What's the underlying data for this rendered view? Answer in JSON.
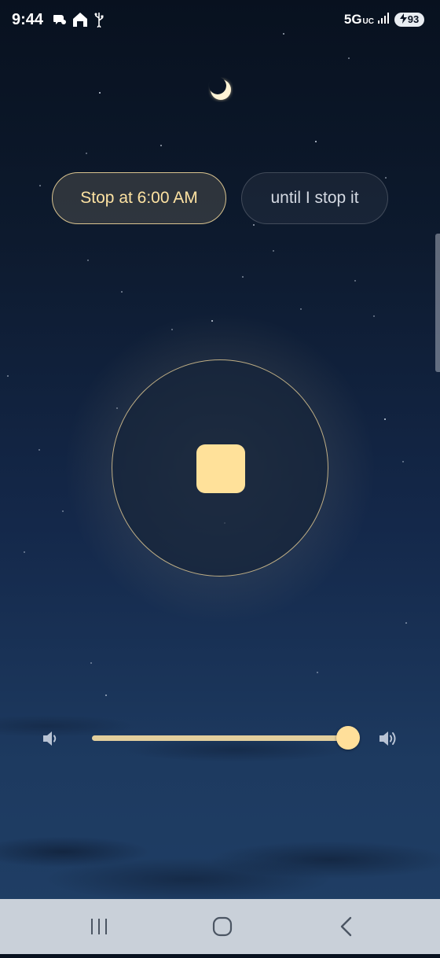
{
  "status_bar": {
    "time": "9:44",
    "network": "5G",
    "network_sub": "UC",
    "battery": "93",
    "icons": [
      "chat-icon",
      "home-signal-icon",
      "usb-icon",
      "signal-icon",
      "battery-charging-icon"
    ]
  },
  "timer_options": {
    "stop_at_label": "Stop at 6:00 AM",
    "until_label": "until I stop it",
    "selected": "stop_at"
  },
  "player": {
    "state": "playing",
    "control_icon": "stop-icon"
  },
  "volume": {
    "level": 0.98,
    "low_icon": "volume-low-icon",
    "high_icon": "volume-high-icon"
  },
  "nav_bar": {
    "buttons": [
      "recents-icon",
      "home-icon",
      "back-icon"
    ]
  },
  "colors": {
    "accent": "#ffe19a",
    "pill_border": "#d9c38f",
    "background_top": "#08111f",
    "background_bottom": "#203f66"
  }
}
